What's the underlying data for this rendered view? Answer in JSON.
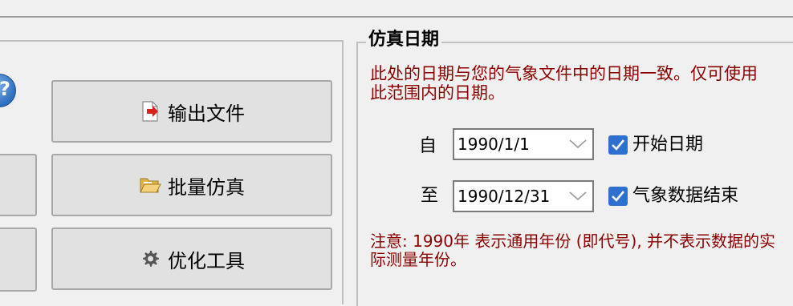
{
  "left": {
    "buttons": [
      {
        "label": "输出文件",
        "icon": "export-file-icon"
      },
      {
        "label": "批量仿真",
        "icon": "folder-open-icon"
      },
      {
        "label": "优化工具",
        "icon": "gear-icon"
      }
    ]
  },
  "simulation_dates": {
    "title": "仿真日期",
    "description": "此处的日期与您的气象文件中的日期一致。仅可使用此范围内的日期。",
    "from_label": "自",
    "from_value": "1990/1/1",
    "from_check_label": "开始日期",
    "to_label": "至",
    "to_value": "1990/12/31",
    "to_check_label": "气象数据结束",
    "note": "注意: 1990年 表示通用年份 (即代号), 并不表示数据的实际测量年份。"
  },
  "colors": {
    "accent_text": "#8b0000",
    "checkbox": "#2f6fcf",
    "button_bg": "#e1e1e1"
  }
}
